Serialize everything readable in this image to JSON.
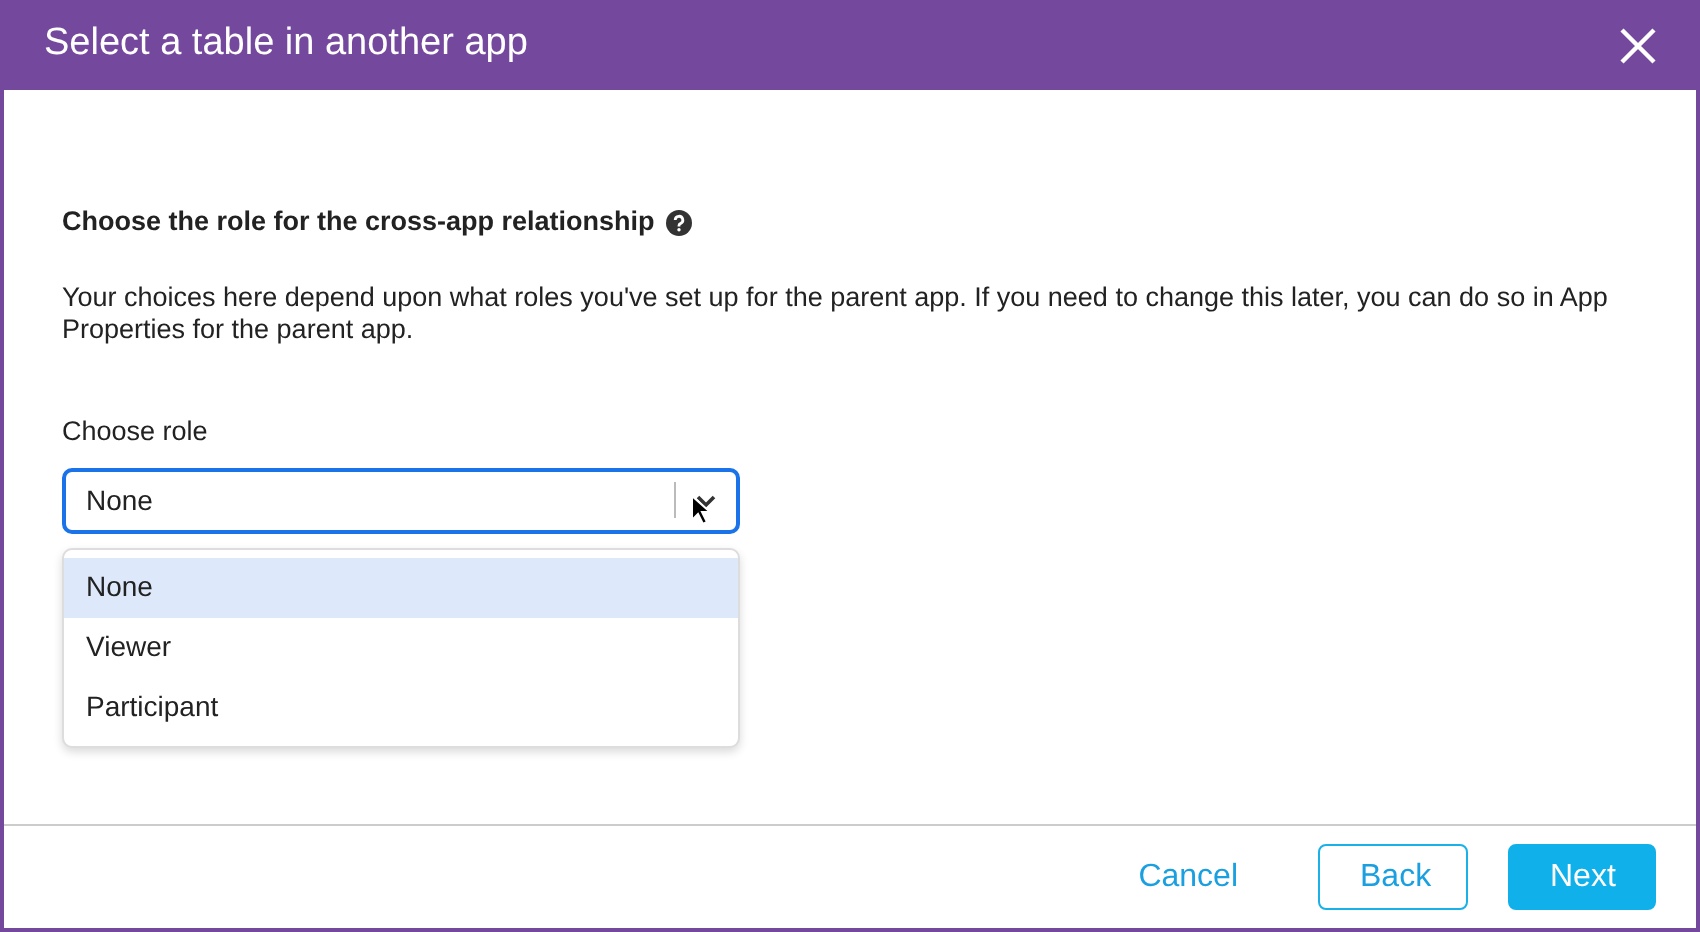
{
  "dialog": {
    "title": "Select a table in another app"
  },
  "section": {
    "heading": "Choose the role for the cross-app relationship",
    "description": "Your choices here depend upon what roles you've set up for the parent app. If you need to change this later, you can do so in App Properties for the parent app."
  },
  "role_field": {
    "label": "Choose role",
    "value": "None",
    "expanded": true
  },
  "options": [
    {
      "label": "None",
      "selected": true
    },
    {
      "label": "Viewer",
      "selected": false
    },
    {
      "label": "Participant",
      "selected": false
    }
  ],
  "buttons": [
    {
      "label": "Cancel",
      "kind": "link"
    },
    {
      "label": "Back",
      "kind": "outline"
    },
    {
      "label": "Next",
      "kind": "primary"
    }
  ]
}
